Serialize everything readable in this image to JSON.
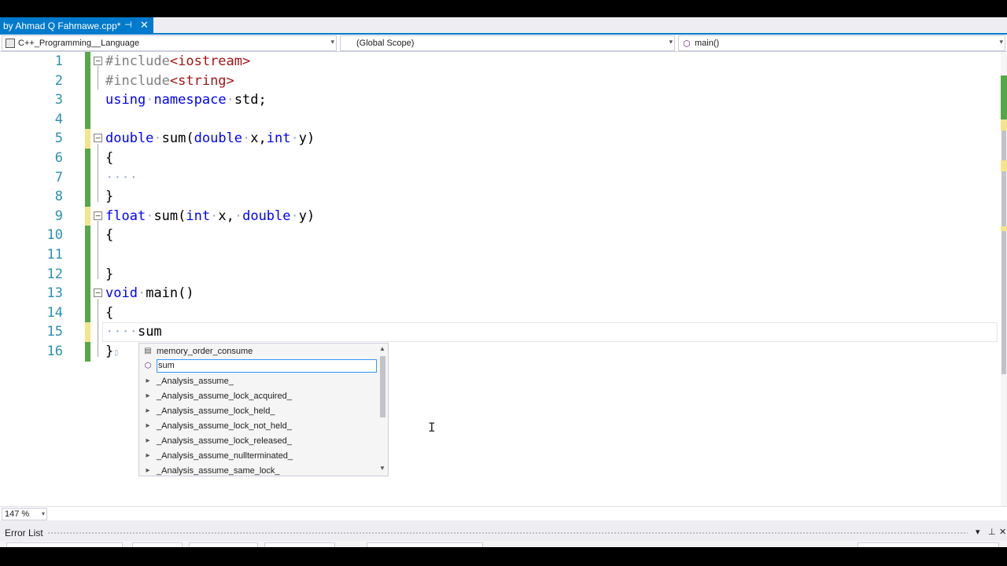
{
  "tab": {
    "title": "by Ahmad Q Fahmawe.cpp*",
    "pin_icon": "pin-icon",
    "close_icon": "close-icon"
  },
  "nav": {
    "project": "C++_Programming__Language",
    "scope": "(Global Scope)",
    "function": "main()"
  },
  "lines": [
    {
      "num": "1"
    },
    {
      "num": "2"
    },
    {
      "num": "3"
    },
    {
      "num": "4"
    },
    {
      "num": "5"
    },
    {
      "num": "6"
    },
    {
      "num": "7"
    },
    {
      "num": "8"
    },
    {
      "num": "9"
    },
    {
      "num": "10"
    },
    {
      "num": "11"
    },
    {
      "num": "12"
    },
    {
      "num": "13"
    },
    {
      "num": "14"
    },
    {
      "num": "15"
    },
    {
      "num": "16"
    }
  ],
  "code": {
    "l1_pp": "#include",
    "l1_str": "<iostream>",
    "l2_pp": "#include",
    "l2_str": "<string>",
    "l3_kw1": "using",
    "l3_kw2": "namespace",
    "l3_rest": "std;",
    "l5_kw1": "double",
    "l5_fn": "sum(",
    "l5_kw2": "double",
    "l5_p1": "x,",
    "l5_kw3": "int",
    "l5_p2": "y)",
    "l6": "{",
    "l7": "····",
    "l8": "}",
    "l9_kw1": "float",
    "l9_fn": "sum(",
    "l9_kw2": "int",
    "l9_p1": "x,",
    "l9_kw3": "double",
    "l9_p2": "y)",
    "l10": "{",
    "l12": "}",
    "l13_kw": "void",
    "l13_rest": "main()",
    "l14": "{",
    "l15_ws": "····",
    "l15_text": "sum",
    "l16": "}"
  },
  "completion": {
    "items": [
      {
        "label": "memory_order_consume",
        "icon": "enum-icon"
      },
      {
        "label": "sum",
        "icon": "function-icon",
        "selected": true
      },
      {
        "label": "_Analysis_assume_",
        "icon": "macro-icon"
      },
      {
        "label": "_Analysis_assume_lock_acquired_",
        "icon": "macro-icon"
      },
      {
        "label": "_Analysis_assume_lock_held_",
        "icon": "macro-icon"
      },
      {
        "label": "_Analysis_assume_lock_not_held_",
        "icon": "macro-icon"
      },
      {
        "label": "_Analysis_assume_lock_released_",
        "icon": "macro-icon"
      },
      {
        "label": "_Analysis_assume_nullterminated_",
        "icon": "macro-icon"
      },
      {
        "label": "_Analysis_assume_same_lock_",
        "icon": "macro-icon"
      }
    ]
  },
  "status": {
    "zoom": "147 %"
  },
  "error_panel": {
    "title": "Error List"
  },
  "colors": {
    "accent": "#007acc",
    "change_bar": "#57a64a",
    "unsaved_change": "#f5e58a",
    "keyword": "#0000ff",
    "string": "#a31515",
    "line_number": "#2b91af"
  }
}
